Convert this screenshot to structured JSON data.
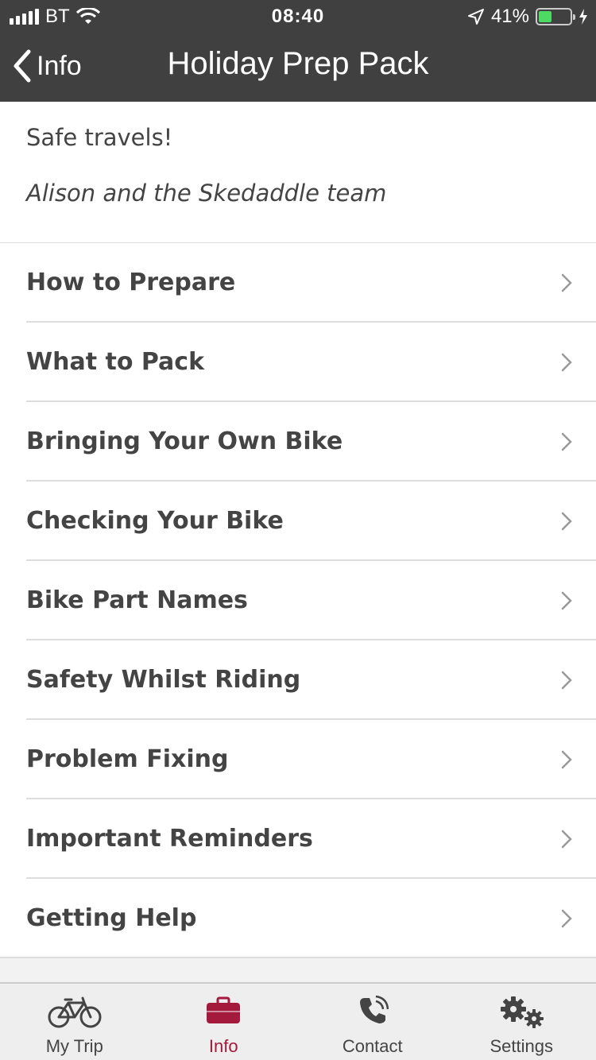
{
  "status_bar": {
    "carrier": "BT",
    "time": "08:40",
    "battery": "41%",
    "battery_level": 0.41
  },
  "nav": {
    "back_label": "Info",
    "title": "Holiday Prep Pack"
  },
  "intro": {
    "line1": "Safe travels!",
    "line2": "Alison and the Skedaddle team"
  },
  "menu": {
    "items": [
      {
        "label": "How to Prepare"
      },
      {
        "label": "What to Pack"
      },
      {
        "label": "Bringing Your Own Bike"
      },
      {
        "label": "Checking Your Bike"
      },
      {
        "label": "Bike Part Names"
      },
      {
        "label": "Safety Whilst Riding"
      },
      {
        "label": "Problem Fixing"
      },
      {
        "label": "Important Reminders"
      },
      {
        "label": "Getting Help"
      }
    ]
  },
  "tabs": [
    {
      "label": "My Trip",
      "icon": "bicycle-icon"
    },
    {
      "label": "Info",
      "icon": "briefcase-icon",
      "active": true
    },
    {
      "label": "Contact",
      "icon": "phone-icon"
    },
    {
      "label": "Settings",
      "icon": "gears-icon"
    }
  ],
  "colors": {
    "header_bg": "#404040",
    "accent": "#a31a3d",
    "battery_fill": "#4cd964"
  }
}
